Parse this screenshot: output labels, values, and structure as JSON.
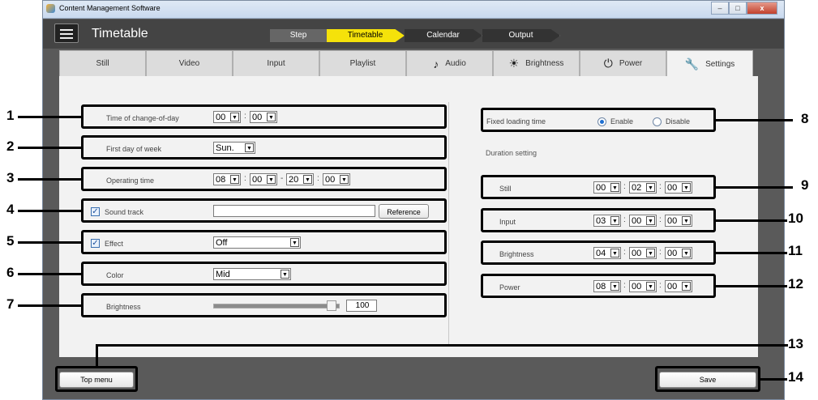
{
  "window": {
    "title": "Content Management Software"
  },
  "header": {
    "title": "Timetable",
    "step_label": "Step",
    "steps": [
      {
        "label": "Timetable",
        "active": true
      },
      {
        "label": "Calendar",
        "active": false
      },
      {
        "label": "Output",
        "active": false
      }
    ]
  },
  "tabs": [
    {
      "label": "Still",
      "icon": ""
    },
    {
      "label": "Video",
      "icon": ""
    },
    {
      "label": "Input",
      "icon": ""
    },
    {
      "label": "Playlist",
      "icon": ""
    },
    {
      "label": "Audio",
      "icon": "music-note-icon"
    },
    {
      "label": "Brightness",
      "icon": "sun-icon"
    },
    {
      "label": "Power",
      "icon": "power-icon"
    },
    {
      "label": "Settings",
      "icon": "wrench-icon",
      "active": true
    }
  ],
  "left": {
    "change_of_day": {
      "label": "Time of change-of-day",
      "hour": "00",
      "minute": "00",
      "colon": ":"
    },
    "first_day": {
      "label": "First day of week",
      "value": "Sun."
    },
    "operating": {
      "label": "Operating time",
      "start_h": "08",
      "start_m": "00",
      "dash": "-",
      "end_h": "20",
      "end_m": "00"
    },
    "sound_track": {
      "label": "Sound track",
      "value": "",
      "button": "Reference"
    },
    "effect": {
      "label": "Effect",
      "value": "Off"
    },
    "color": {
      "label": "Color",
      "value": "Mid"
    },
    "brightness": {
      "label": "Brightness",
      "value": "100",
      "level": 1.0
    }
  },
  "right": {
    "fixed_loading": {
      "label": "Fixed loading time",
      "enable": "Enable",
      "disable": "Disable"
    },
    "duration_title": "Duration setting",
    "durations": [
      {
        "label": "Still",
        "h": "00",
        "m": "02",
        "s": "00"
      },
      {
        "label": "Input",
        "h": "03",
        "m": "00",
        "s": "00"
      },
      {
        "label": "Brightness",
        "h": "04",
        "m": "00",
        "s": "00"
      },
      {
        "label": "Power",
        "h": "08",
        "m": "00",
        "s": "00"
      }
    ]
  },
  "footer": {
    "top_menu": "Top menu",
    "save": "Save"
  },
  "callouts": [
    "1",
    "2",
    "3",
    "4",
    "5",
    "6",
    "7",
    "8",
    "9",
    "10",
    "11",
    "12",
    "13",
    "14"
  ]
}
